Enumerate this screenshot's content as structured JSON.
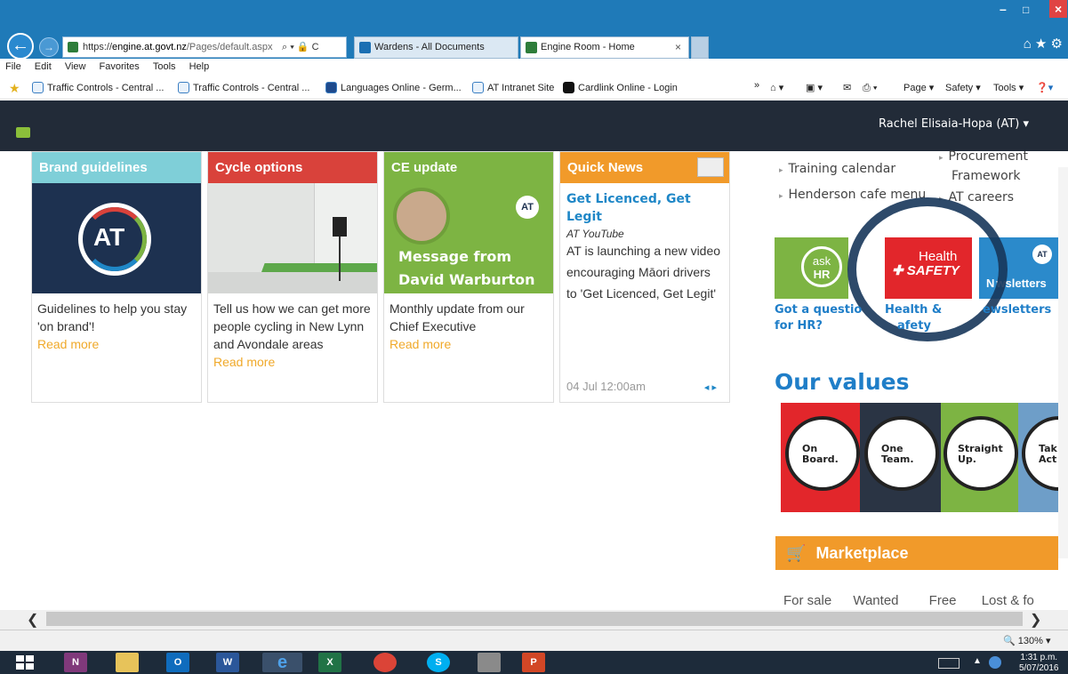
{
  "browser": {
    "url_prefix": "https://",
    "url_host": "engine.at.govt.nz",
    "url_path": "/Pages/default.aspx",
    "search_glyph": "⌕ ▾ 🔒 C",
    "tabs": [
      {
        "label": "Wardens - All Documents",
        "active": false
      },
      {
        "label": "Engine Room - Home",
        "active": true
      }
    ],
    "tab_close": "×",
    "window_controls": {
      "min": "–",
      "max": "□",
      "close": "×"
    },
    "toolbar_icons": "⌂ ★ ⚙"
  },
  "menu": [
    "File",
    "Edit",
    "View",
    "Favorites",
    "Tools",
    "Help"
  ],
  "favorites": [
    "Traffic Controls - Central ...",
    "Traffic Controls - Central ...",
    "Languages Online - Germ...",
    "AT Intranet Site",
    "Cardlink Online - Login"
  ],
  "command_bar": {
    "overflow": "»",
    "page": "Page ▾",
    "safety": "Safety ▾",
    "tools": "Tools ▾"
  },
  "site": {
    "user": "Rachel Elisaia-Hopa (AT) ▾"
  },
  "cards": [
    {
      "title": "Brand guidelines",
      "color": "#7fcfd8",
      "text": "Guidelines to help you stay 'on brand'!",
      "more": "Read more"
    },
    {
      "title": "Cycle options",
      "color": "#d9423b",
      "text": "Tell us how we can get more people cycling in New Lynn and Avondale areas",
      "more": "Read more"
    },
    {
      "title": "CE update",
      "color": "#7db443",
      "text": "Monthly update from our Chief Executive",
      "more": "Read more",
      "img_line1": "Message from",
      "img_line2": "David Warburton"
    },
    {
      "title": "Quick News",
      "color": "#f19a2a"
    }
  ],
  "brand_logo": "AT",
  "quick_news": {
    "title": "Get Licenced, Get Legit",
    "source": "AT YouTube",
    "desc": "AT is launching a new video encouraging Māori drivers to 'Get Licenced, Get Legit'",
    "date": "04 Jul 12:00am",
    "nav": "◂ ▸"
  },
  "right": {
    "links": {
      "training": "Training calendar",
      "cafe": "Henderson cafe menu",
      "procurement1": "Procurement",
      "procurement2": "Framework",
      "careers": "AT careers",
      "bullet": "▸"
    },
    "tiles": {
      "askhr_top": "ask",
      "askhr_bottom": "HR",
      "health_top": "Health",
      "health_bottom": "SAFETY",
      "newsletter_tile": "wsletters",
      "newsletter_tile_prefix": "N"
    },
    "captions": {
      "askhr": "Got a questio",
      "askhr2": "for HR?",
      "health": "Health &",
      "health2": "afety",
      "news": "ewsletters"
    },
    "values_heading": "Our values",
    "values": [
      {
        "l1": "On",
        "l2": "Board."
      },
      {
        "l1": "One",
        "l2": "Team."
      },
      {
        "l1": "Straight",
        "l2": "Up."
      },
      {
        "l1": "Tak",
        "l2": "Act"
      }
    ],
    "marketplace": "Marketplace",
    "market_tabs": [
      "For sale",
      "Wanted",
      "Free",
      "Lost & fo"
    ]
  },
  "status": {
    "zoom": "130%",
    "time": "1:31 p.m.",
    "date": "5/07/2016"
  },
  "colors": {
    "header_bg": "#222b38",
    "link_blue": "#1f87c7",
    "read_more": "#f0a92a",
    "ie_blue": "#1f7ab8"
  }
}
